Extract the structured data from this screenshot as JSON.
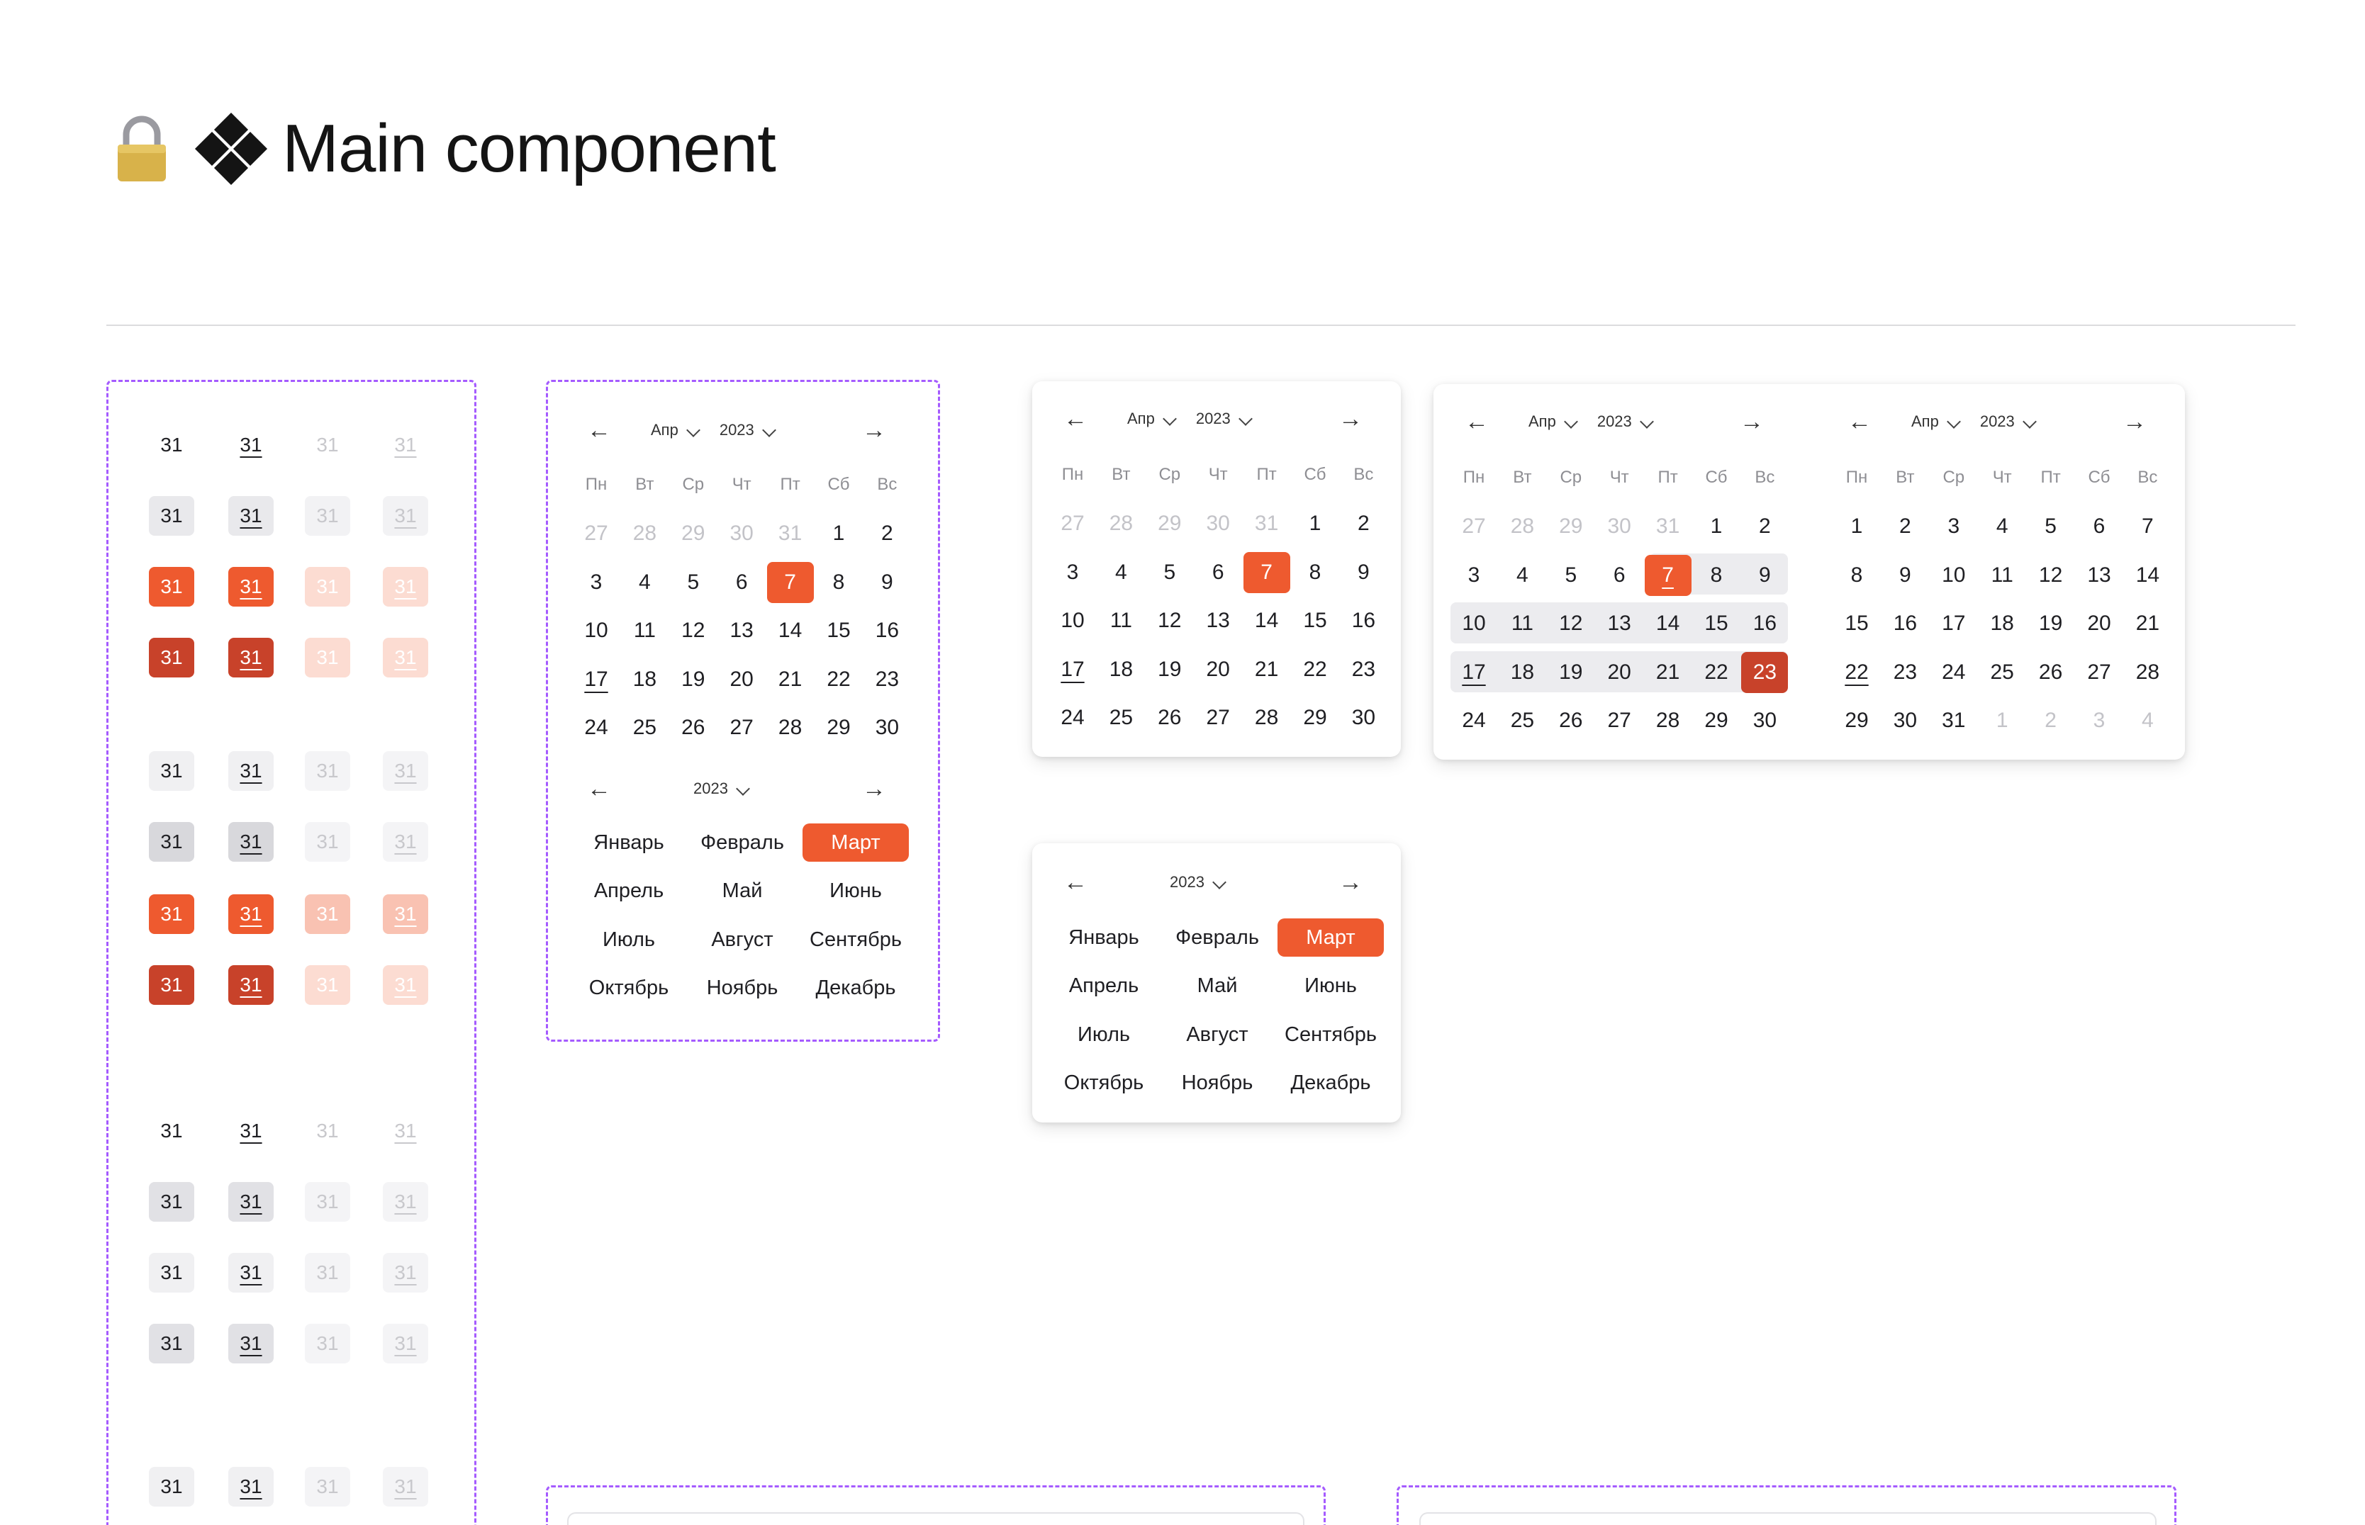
{
  "title": "Main component",
  "icons": {
    "lock": "lock-icon",
    "component": "component-diamond-icon",
    "prev": "arrow-left-icon",
    "next": "arrow-right-icon",
    "chevron": "chevron-down-icon",
    "calendar": "calendar-icon"
  },
  "colors": {
    "accent": "#ee5a2f",
    "accent_dark": "#c8422a",
    "range": "#ececef",
    "variant_outline": "#a55bff"
  },
  "variants_cell": "31",
  "weekdays": [
    "Пн",
    "Вт",
    "Ср",
    "Чт",
    "Пт",
    "Сб",
    "Вс"
  ],
  "header": {
    "month": "Апр",
    "year": "2023"
  },
  "months": [
    "Январь",
    "Февраль",
    "Март",
    "Апрель",
    "Май",
    "Июнь",
    "Июль",
    "Август",
    "Сентябрь",
    "Октябрь",
    "Ноябрь",
    "Декабрь"
  ],
  "selected_month": "Март",
  "april_days": [
    "27",
    "28",
    "29",
    "30",
    "31",
    "1",
    "2",
    "3",
    "4",
    "5",
    "6",
    "7",
    "8",
    "9",
    "10",
    "11",
    "12",
    "13",
    "14",
    "15",
    "16",
    "17",
    "18",
    "19",
    "20",
    "21",
    "22",
    "23",
    "24",
    "25",
    "26",
    "27",
    "28",
    "29",
    "30"
  ],
  "may_days": [
    "1",
    "2",
    "3",
    "4",
    "5",
    "6",
    "7",
    "8",
    "9",
    "10",
    "11",
    "12",
    "13",
    "14",
    "15",
    "16",
    "17",
    "18",
    "19",
    "20",
    "21",
    "22",
    "23",
    "24",
    "25",
    "26",
    "27",
    "28",
    "29",
    "30",
    "31",
    "1",
    "2",
    "3",
    "4"
  ]
}
